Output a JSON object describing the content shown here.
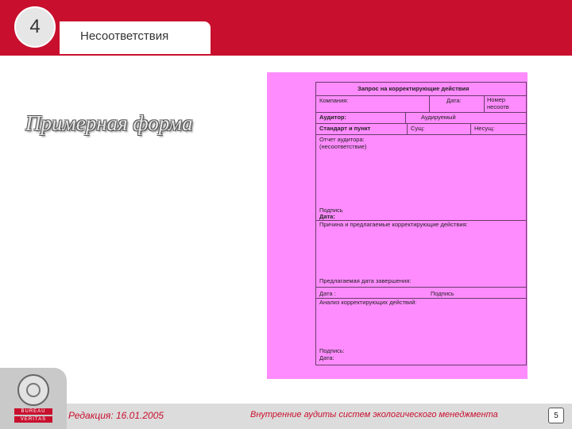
{
  "header": {
    "section_number": "4",
    "section_title": "Несоответствия"
  },
  "main": {
    "title": "Примерная форма"
  },
  "form": {
    "heading": "Запрос на корректирующие действия",
    "company": "Компания:",
    "date": "Дата:",
    "number_line1": "Номер",
    "number_line2": "несоотв",
    "auditor": "Аудитор:",
    "auditee": "Аудируемый",
    "standard": "Стандарт и пункт",
    "sush": "Сущ:",
    "nesush": "Несущ:",
    "report_line1": "Отчет аудитора:",
    "report_line2": "(несоответствие)",
    "sign1": "Подпись",
    "date1": "Дата:",
    "cause": "Причина и предлагаемые корректирующие действия:",
    "proposed_date": "Предлагаемая дата завершения:",
    "date2": "Дата :",
    "sign2": "Подпись",
    "analysis": "Анализ корректирующих действий:",
    "sign3": "Подпись:",
    "date3": "Дата:"
  },
  "footer": {
    "edition": "Редакция: 16.01.2005",
    "course": "Внутренние аудиты систем экологического менеджмента",
    "page": "5",
    "logo_line1": "BUREAU",
    "logo_line2": "VERITAS"
  },
  "colors": {
    "brand_red": "#c8102e",
    "form_pink": "#ff8cff"
  }
}
